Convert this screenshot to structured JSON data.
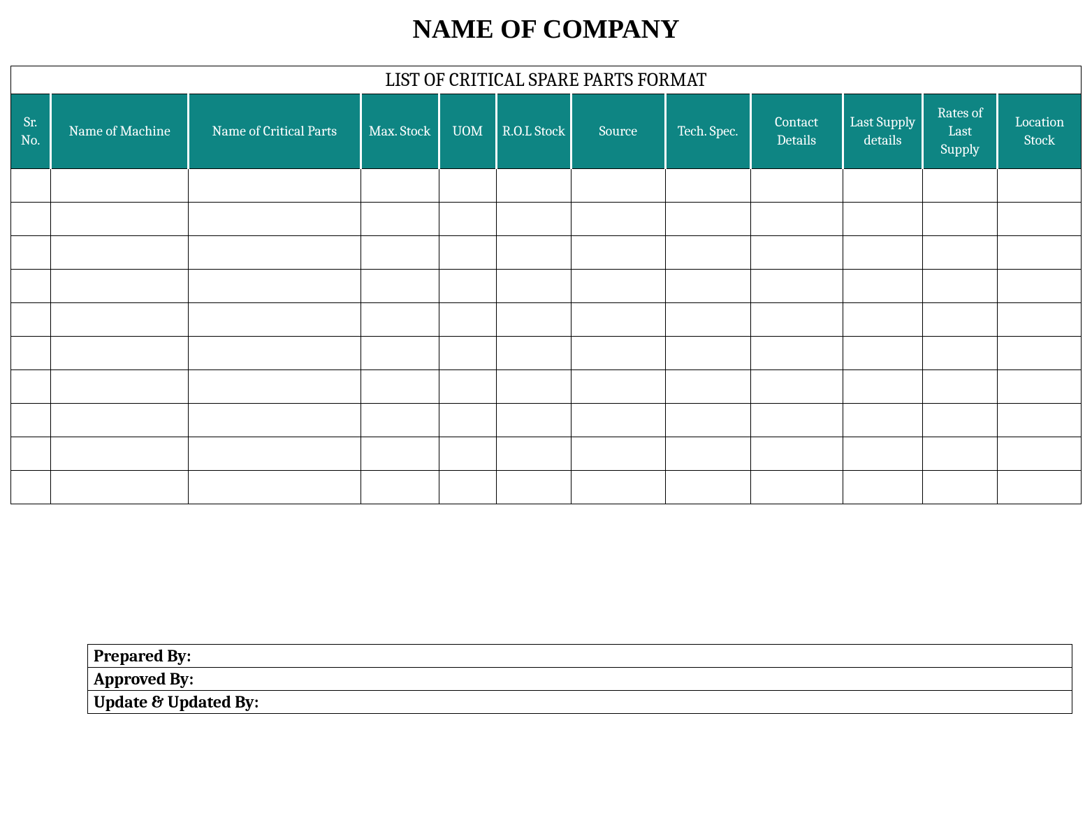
{
  "header": {
    "company_name": "NAME OF COMPANY"
  },
  "table": {
    "title": "LIST OF CRITICAL SPARE PARTS FORMAT",
    "columns": {
      "sr_no": "Sr. No.",
      "machine": "Name of Machine",
      "parts": "Name of Critical Parts",
      "max_stock": "Max. Stock",
      "uom": "UOM",
      "rol_stock": "R.O.L Stock",
      "source": "Source",
      "tech_spec": "Tech. Spec.",
      "contact": "Contact Details",
      "last_supply": "Last Supply details",
      "rates": "Rates of Last Supply",
      "location": "Location Stock"
    },
    "rows": [
      {
        "sr": "",
        "machine": "",
        "parts": "",
        "max": "",
        "uom": "",
        "rol": "",
        "source": "",
        "tech": "",
        "contact": "",
        "last": "",
        "rates": "",
        "loc": ""
      },
      {
        "sr": "",
        "machine": "",
        "parts": "",
        "max": "",
        "uom": "",
        "rol": "",
        "source": "",
        "tech": "",
        "contact": "",
        "last": "",
        "rates": "",
        "loc": ""
      },
      {
        "sr": "",
        "machine": "",
        "parts": "",
        "max": "",
        "uom": "",
        "rol": "",
        "source": "",
        "tech": "",
        "contact": "",
        "last": "",
        "rates": "",
        "loc": ""
      },
      {
        "sr": "",
        "machine": "",
        "parts": "",
        "max": "",
        "uom": "",
        "rol": "",
        "source": "",
        "tech": "",
        "contact": "",
        "last": "",
        "rates": "",
        "loc": ""
      },
      {
        "sr": "",
        "machine": "",
        "parts": "",
        "max": "",
        "uom": "",
        "rol": "",
        "source": "",
        "tech": "",
        "contact": "",
        "last": "",
        "rates": "",
        "loc": ""
      },
      {
        "sr": "",
        "machine": "",
        "parts": "",
        "max": "",
        "uom": "",
        "rol": "",
        "source": "",
        "tech": "",
        "contact": "",
        "last": "",
        "rates": "",
        "loc": ""
      },
      {
        "sr": "",
        "machine": "",
        "parts": "",
        "max": "",
        "uom": "",
        "rol": "",
        "source": "",
        "tech": "",
        "contact": "",
        "last": "",
        "rates": "",
        "loc": ""
      },
      {
        "sr": "",
        "machine": "",
        "parts": "",
        "max": "",
        "uom": "",
        "rol": "",
        "source": "",
        "tech": "",
        "contact": "",
        "last": "",
        "rates": "",
        "loc": ""
      },
      {
        "sr": "",
        "machine": "",
        "parts": "",
        "max": "",
        "uom": "",
        "rol": "",
        "source": "",
        "tech": "",
        "contact": "",
        "last": "",
        "rates": "",
        "loc": ""
      },
      {
        "sr": "",
        "machine": "",
        "parts": "",
        "max": "",
        "uom": "",
        "rol": "",
        "source": "",
        "tech": "",
        "contact": "",
        "last": "",
        "rates": "",
        "loc": ""
      }
    ]
  },
  "footer": {
    "prepared_by": "Prepared By:",
    "approved_by": "Approved By:",
    "updated_by": "Update & Updated By:"
  }
}
